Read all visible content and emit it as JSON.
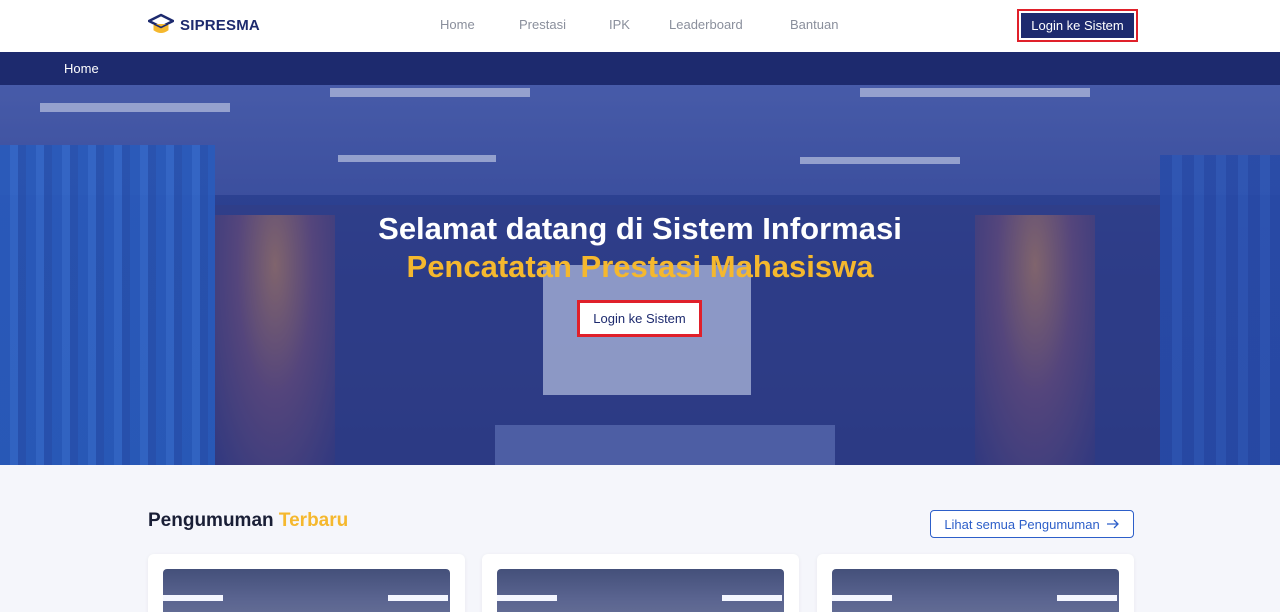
{
  "brand": {
    "name": "SIPRESMA"
  },
  "nav": {
    "items": [
      {
        "label": "Home"
      },
      {
        "label": "Prestasi"
      },
      {
        "label": "IPK"
      },
      {
        "label": "Leaderboard"
      },
      {
        "label": "Bantuan"
      }
    ],
    "login_label": "Login ke Sistem"
  },
  "breadcrumb": {
    "current": "Home"
  },
  "hero": {
    "title_line1": "Selamat datang di Sistem Informasi",
    "title_line2": "Pencatatan Prestasi Mahasiswa",
    "login_label": "Login ke Sistem"
  },
  "announcements": {
    "title_main": "Pengumuman",
    "title_accent": "Terbaru",
    "see_all_label": "Lihat semua Pengumuman"
  },
  "colors": {
    "primary": "#1d2a6e",
    "accent": "#f5b82e",
    "highlight": "#e0202a",
    "link": "#2d5fc9"
  }
}
